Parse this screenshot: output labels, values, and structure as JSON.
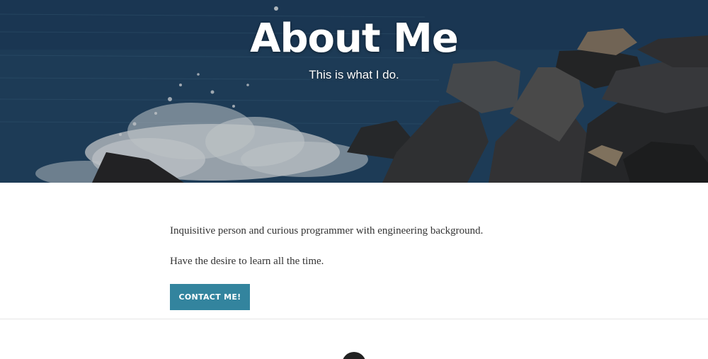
{
  "hero": {
    "title": "About Me",
    "subtitle": "This is what I do."
  },
  "content": {
    "paragraphs": [
      "Inquisitive person and curious programmer with engineering background.",
      "Have the desire to learn all the time."
    ],
    "contact_button_label": "CONTACT ME!"
  },
  "colors": {
    "button": "#33849e",
    "text": "#333333",
    "sea": "#27506f"
  }
}
